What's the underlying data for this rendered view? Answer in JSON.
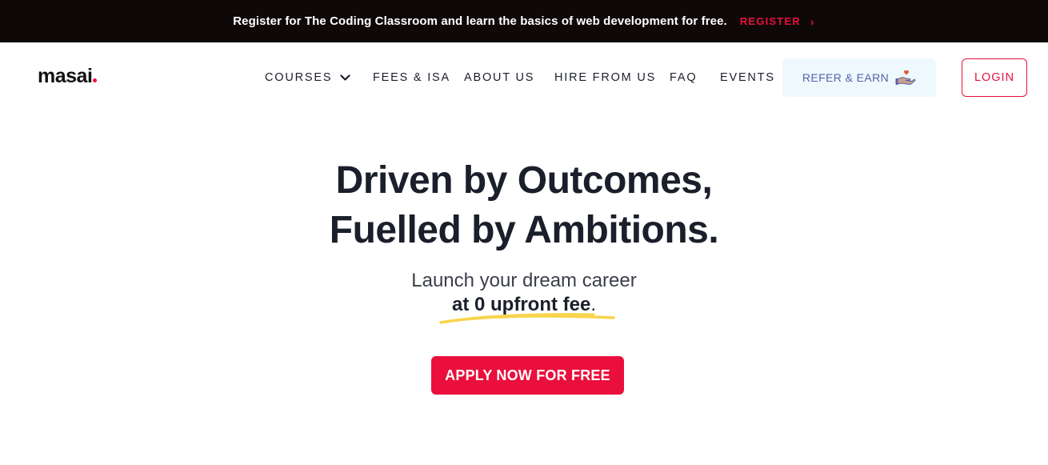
{
  "announcement": {
    "text": "Register for The Coding Classroom and learn the basics of web development for free.",
    "register_label": "REGISTER"
  },
  "header": {
    "logo": "masai",
    "nav": {
      "courses": "COURSES",
      "fees": "FEES & ISA",
      "about": "ABOUT US",
      "hire": "HIRE FROM US",
      "faq": "FAQ",
      "events": "EVENTS"
    },
    "refer_label": "REFER & EARN",
    "login_label": "LOGIN"
  },
  "hero": {
    "title_line1": "Driven by Outcomes,",
    "title_line2": "Fuelled by Ambitions.",
    "subtitle_line1": "Launch your dream career",
    "subtitle_highlight": "at 0 upfront fee",
    "subtitle_end": ".",
    "cta_label": "APPLY NOW FOR FREE"
  },
  "colors": {
    "brand_red": "#ea0f3c",
    "dark": "#0f0808",
    "refer_bg": "#eef9fd",
    "highlight_yellow": "#f7d44c"
  }
}
